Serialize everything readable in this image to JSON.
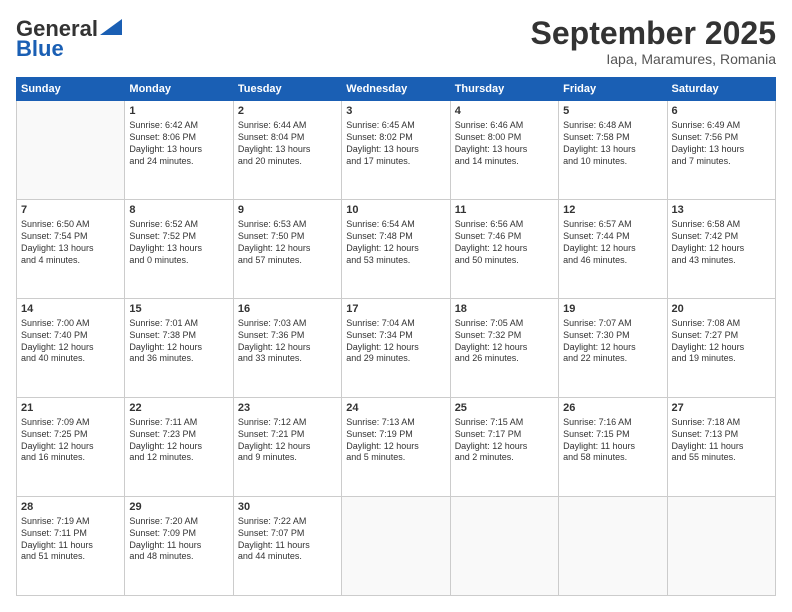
{
  "logo": {
    "general": "General",
    "blue": "Blue"
  },
  "header": {
    "month": "September 2025",
    "location": "Iapa, Maramures, Romania"
  },
  "weekdays": [
    "Sunday",
    "Monday",
    "Tuesday",
    "Wednesday",
    "Thursday",
    "Friday",
    "Saturday"
  ],
  "weeks": [
    [
      {
        "day": "",
        "content": ""
      },
      {
        "day": "1",
        "content": "Sunrise: 6:42 AM\nSunset: 8:06 PM\nDaylight: 13 hours\nand 24 minutes."
      },
      {
        "day": "2",
        "content": "Sunrise: 6:44 AM\nSunset: 8:04 PM\nDaylight: 13 hours\nand 20 minutes."
      },
      {
        "day": "3",
        "content": "Sunrise: 6:45 AM\nSunset: 8:02 PM\nDaylight: 13 hours\nand 17 minutes."
      },
      {
        "day": "4",
        "content": "Sunrise: 6:46 AM\nSunset: 8:00 PM\nDaylight: 13 hours\nand 14 minutes."
      },
      {
        "day": "5",
        "content": "Sunrise: 6:48 AM\nSunset: 7:58 PM\nDaylight: 13 hours\nand 10 minutes."
      },
      {
        "day": "6",
        "content": "Sunrise: 6:49 AM\nSunset: 7:56 PM\nDaylight: 13 hours\nand 7 minutes."
      }
    ],
    [
      {
        "day": "7",
        "content": "Sunrise: 6:50 AM\nSunset: 7:54 PM\nDaylight: 13 hours\nand 4 minutes."
      },
      {
        "day": "8",
        "content": "Sunrise: 6:52 AM\nSunset: 7:52 PM\nDaylight: 13 hours\nand 0 minutes."
      },
      {
        "day": "9",
        "content": "Sunrise: 6:53 AM\nSunset: 7:50 PM\nDaylight: 12 hours\nand 57 minutes."
      },
      {
        "day": "10",
        "content": "Sunrise: 6:54 AM\nSunset: 7:48 PM\nDaylight: 12 hours\nand 53 minutes."
      },
      {
        "day": "11",
        "content": "Sunrise: 6:56 AM\nSunset: 7:46 PM\nDaylight: 12 hours\nand 50 minutes."
      },
      {
        "day": "12",
        "content": "Sunrise: 6:57 AM\nSunset: 7:44 PM\nDaylight: 12 hours\nand 46 minutes."
      },
      {
        "day": "13",
        "content": "Sunrise: 6:58 AM\nSunset: 7:42 PM\nDaylight: 12 hours\nand 43 minutes."
      }
    ],
    [
      {
        "day": "14",
        "content": "Sunrise: 7:00 AM\nSunset: 7:40 PM\nDaylight: 12 hours\nand 40 minutes."
      },
      {
        "day": "15",
        "content": "Sunrise: 7:01 AM\nSunset: 7:38 PM\nDaylight: 12 hours\nand 36 minutes."
      },
      {
        "day": "16",
        "content": "Sunrise: 7:03 AM\nSunset: 7:36 PM\nDaylight: 12 hours\nand 33 minutes."
      },
      {
        "day": "17",
        "content": "Sunrise: 7:04 AM\nSunset: 7:34 PM\nDaylight: 12 hours\nand 29 minutes."
      },
      {
        "day": "18",
        "content": "Sunrise: 7:05 AM\nSunset: 7:32 PM\nDaylight: 12 hours\nand 26 minutes."
      },
      {
        "day": "19",
        "content": "Sunrise: 7:07 AM\nSunset: 7:30 PM\nDaylight: 12 hours\nand 22 minutes."
      },
      {
        "day": "20",
        "content": "Sunrise: 7:08 AM\nSunset: 7:27 PM\nDaylight: 12 hours\nand 19 minutes."
      }
    ],
    [
      {
        "day": "21",
        "content": "Sunrise: 7:09 AM\nSunset: 7:25 PM\nDaylight: 12 hours\nand 16 minutes."
      },
      {
        "day": "22",
        "content": "Sunrise: 7:11 AM\nSunset: 7:23 PM\nDaylight: 12 hours\nand 12 minutes."
      },
      {
        "day": "23",
        "content": "Sunrise: 7:12 AM\nSunset: 7:21 PM\nDaylight: 12 hours\nand 9 minutes."
      },
      {
        "day": "24",
        "content": "Sunrise: 7:13 AM\nSunset: 7:19 PM\nDaylight: 12 hours\nand 5 minutes."
      },
      {
        "day": "25",
        "content": "Sunrise: 7:15 AM\nSunset: 7:17 PM\nDaylight: 12 hours\nand 2 minutes."
      },
      {
        "day": "26",
        "content": "Sunrise: 7:16 AM\nSunset: 7:15 PM\nDaylight: 11 hours\nand 58 minutes."
      },
      {
        "day": "27",
        "content": "Sunrise: 7:18 AM\nSunset: 7:13 PM\nDaylight: 11 hours\nand 55 minutes."
      }
    ],
    [
      {
        "day": "28",
        "content": "Sunrise: 7:19 AM\nSunset: 7:11 PM\nDaylight: 11 hours\nand 51 minutes."
      },
      {
        "day": "29",
        "content": "Sunrise: 7:20 AM\nSunset: 7:09 PM\nDaylight: 11 hours\nand 48 minutes."
      },
      {
        "day": "30",
        "content": "Sunrise: 7:22 AM\nSunset: 7:07 PM\nDaylight: 11 hours\nand 44 minutes."
      },
      {
        "day": "",
        "content": ""
      },
      {
        "day": "",
        "content": ""
      },
      {
        "day": "",
        "content": ""
      },
      {
        "day": "",
        "content": ""
      }
    ]
  ]
}
